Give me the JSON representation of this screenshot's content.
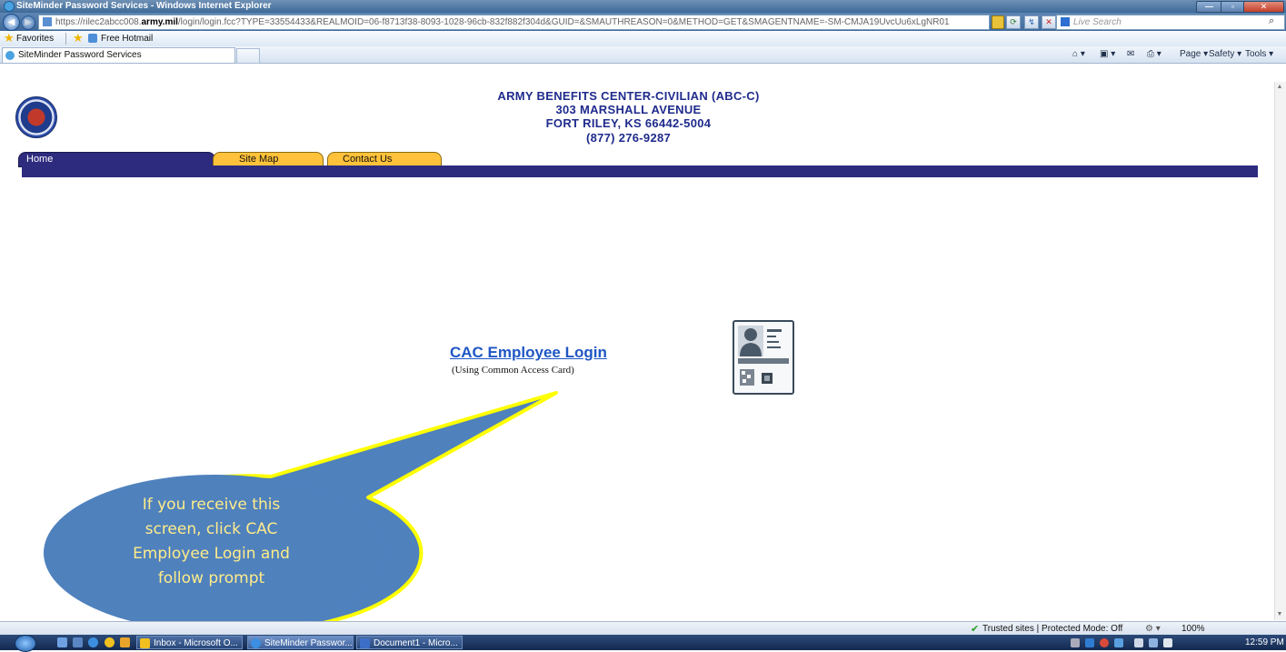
{
  "browser": {
    "window_title": "SiteMinder Password Services - Windows Internet Explorer",
    "address_prefix": "https://rilec2abcc008.",
    "address_domain": "army.mil",
    "address_rest": "/login/login.fcc?TYPE=33554433&REALMOID=06-f8713f38-8093-1028-96cb-832f882f304d&GUID=&SMAUTHREASON=0&METHOD=GET&SMAGENTNAME=-SM-CMJA19UvcUu6xLgNR01",
    "search_placeholder": "Live Search",
    "favorites_label": "Favorites",
    "favorite_link": "Free Hotmail",
    "tab_title": "SiteMinder Password Services",
    "commands": {
      "page": "Page ▾",
      "safety": "Safety ▾",
      "tools": "Tools ▾"
    }
  },
  "page": {
    "header": {
      "line1": "ARMY BENEFITS CENTER-CIVILIAN (ABC-C)",
      "line2": "303 MARSHALL AVENUE",
      "line3": "FORT RILEY, KS 66442-5004",
      "line4": "(877) 276-9287"
    },
    "nav_tabs": {
      "home": "Home",
      "site_map": "Site Map",
      "contact_us": "Contact Us"
    },
    "login": {
      "link_text": "CAC Employee Login",
      "subtitle": "(Using Common Access Card)"
    },
    "callout": {
      "line1": "If you receive this",
      "line2": "screen, click CAC",
      "line3": "Employee Login and",
      "line4": "follow prompt"
    }
  },
  "status_bar": {
    "zone": "Trusted sites | Protected Mode: Off",
    "zoom": "100%"
  },
  "taskbar": {
    "tasks": {
      "inbox": "Inbox - Microsoft O...",
      "siteminder": "SiteMinder Passwor...",
      "document": "Document1 - Micro..."
    },
    "clock": "12:59 PM"
  },
  "colors": {
    "nav_band": "#2d2b7e",
    "tab_gold": "#ffc23a",
    "header_text": "#1f2b8c",
    "callout_fill": "#4f81bd",
    "callout_border": "#ffff00",
    "callout_text": "#ffec8a",
    "link_blue": "#1f56c4"
  }
}
